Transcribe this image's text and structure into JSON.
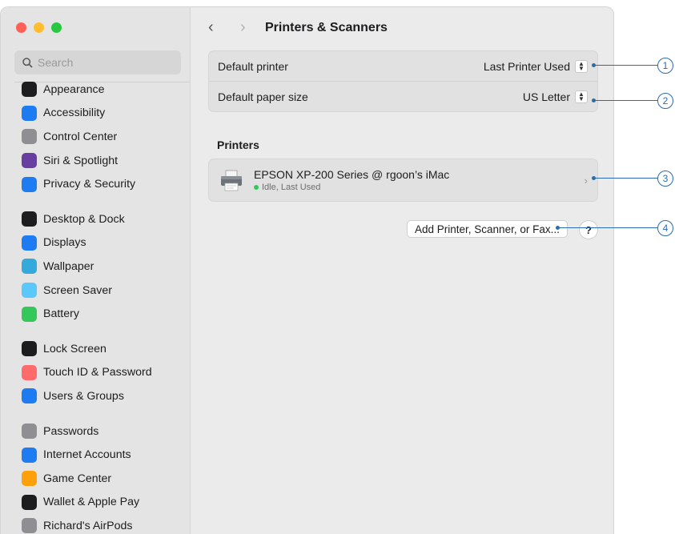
{
  "window": {
    "traffic_lights": {
      "close": "#fe5f57",
      "minimize": "#febc2e",
      "zoom": "#28c840"
    }
  },
  "sidebar": {
    "search_placeholder": "Search",
    "items": [
      {
        "label": "Appearance",
        "icon": "appearance-icon",
        "color": "#1d1d1f"
      },
      {
        "label": "Accessibility",
        "icon": "accessibility-icon",
        "color": "#1e7cf2"
      },
      {
        "label": "Control Center",
        "icon": "control-center-icon",
        "color": "#8e8e93"
      },
      {
        "label": "Siri & Spotlight",
        "icon": "siri-icon",
        "color": "#6a3ea1"
      },
      {
        "label": "Privacy & Security",
        "icon": "hand-icon",
        "color": "#1e7cf2"
      },
      {
        "label": "Desktop & Dock",
        "icon": "dock-icon",
        "color": "#1d1d1f"
      },
      {
        "label": "Displays",
        "icon": "sun-icon",
        "color": "#1e7cf2"
      },
      {
        "label": "Wallpaper",
        "icon": "wallpaper-icon",
        "color": "#34aadc"
      },
      {
        "label": "Screen Saver",
        "icon": "screen-saver-icon",
        "color": "#5ac8fa"
      },
      {
        "label": "Battery",
        "icon": "battery-icon",
        "color": "#34c759"
      },
      {
        "label": "Lock Screen",
        "icon": "lock-icon",
        "color": "#1d1d1f"
      },
      {
        "label": "Touch ID & Password",
        "icon": "fingerprint-icon",
        "color": "#ff6b6b"
      },
      {
        "label": "Users & Groups",
        "icon": "users-icon",
        "color": "#1e7cf2"
      },
      {
        "label": "Passwords",
        "icon": "key-icon",
        "color": "#8e8e93"
      },
      {
        "label": "Internet Accounts",
        "icon": "at-icon",
        "color": "#1e7cf2"
      },
      {
        "label": "Game Center",
        "icon": "game-center-icon",
        "color": "#ff9f0a"
      },
      {
        "label": "Wallet & Apple Pay",
        "icon": "wallet-icon",
        "color": "#1d1d1f"
      },
      {
        "label": "Richard's AirPods",
        "icon": "airpods-icon",
        "color": "#8e8e93"
      }
    ]
  },
  "header": {
    "title": "Printers & Scanners"
  },
  "defaults": {
    "printer_label": "Default printer",
    "printer_value": "Last Printer Used",
    "paper_label": "Default paper size",
    "paper_value": "US Letter"
  },
  "printers": {
    "section_title": "Printers",
    "items": [
      {
        "name": "EPSON XP-200 Series @ rgoon’s iMac",
        "status": "Idle, Last Used"
      }
    ]
  },
  "actions": {
    "add_label": "Add Printer, Scanner, or Fax...",
    "help_label": "?"
  },
  "callouts": [
    "1",
    "2",
    "3",
    "4"
  ]
}
